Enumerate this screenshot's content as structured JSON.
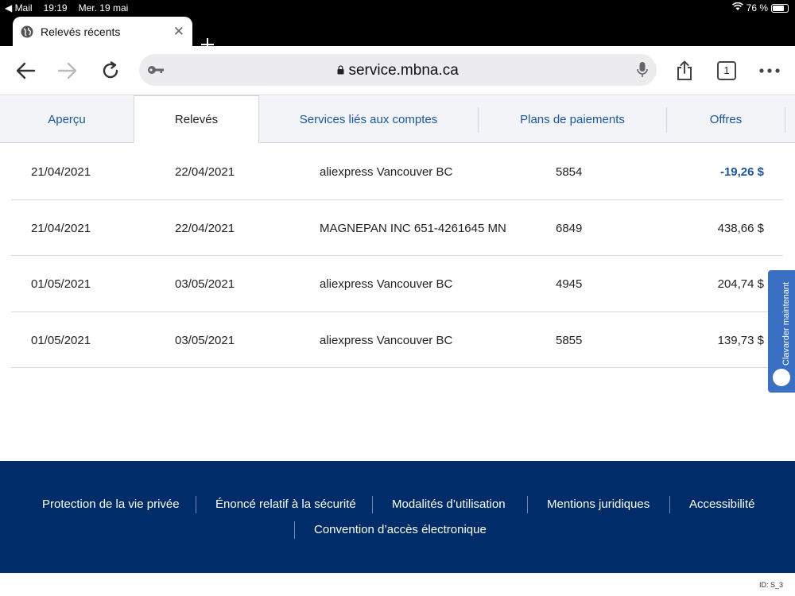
{
  "status_bar": {
    "back_app": "◀ Mail",
    "time": "19:19",
    "date": "Mer. 19 mai",
    "battery": "76 %",
    "battery_level": 0.76
  },
  "browser": {
    "tab_title": "Relevés récents",
    "url": "service.mbna.ca",
    "tab_count": "1"
  },
  "site_nav": {
    "tabs": [
      {
        "label": "Aperçu"
      },
      {
        "label": "Relevés"
      },
      {
        "label": "Services liés aux comptes"
      },
      {
        "label": "Plans de paiements"
      },
      {
        "label": "Offres"
      }
    ]
  },
  "transactions": [
    {
      "transaction_date": "21/04/2021",
      "posting_date": "22/04/2021",
      "description": "aliexpress Vancouver BC",
      "reference": "5854",
      "amount": "-19,26 $"
    },
    {
      "transaction_date": "21/04/2021",
      "posting_date": "22/04/2021",
      "description": "MAGNEPAN INC 651-4261645 MN",
      "reference": "6849",
      "amount": "438,66 $"
    },
    {
      "transaction_date": "01/05/2021",
      "posting_date": "03/05/2021",
      "description": "aliexpress Vancouver BC",
      "reference": "4945",
      "amount": "204,74 $"
    },
    {
      "transaction_date": "01/05/2021",
      "posting_date": "03/05/2021",
      "description": "aliexpress Vancouver BC",
      "reference": "5855",
      "amount": "139,73 $"
    }
  ],
  "chat": {
    "label": "Clavarder maintenant"
  },
  "footer": {
    "links": [
      {
        "label": "Protection de la vie privée"
      },
      {
        "label": "Énoncé relatif à la sécurité"
      },
      {
        "label": "Modalités d’utilisation"
      },
      {
        "label": "Mentions juridiques"
      },
      {
        "label": "Accessibilité"
      },
      {
        "label": "Convention d’accès électronique"
      }
    ]
  },
  "page_id": "ID: S_3",
  "colors": {
    "brand_blue": "#1a56a3",
    "footer_navy": "#002d6a",
    "chat_blue": "#3a6fc4"
  }
}
